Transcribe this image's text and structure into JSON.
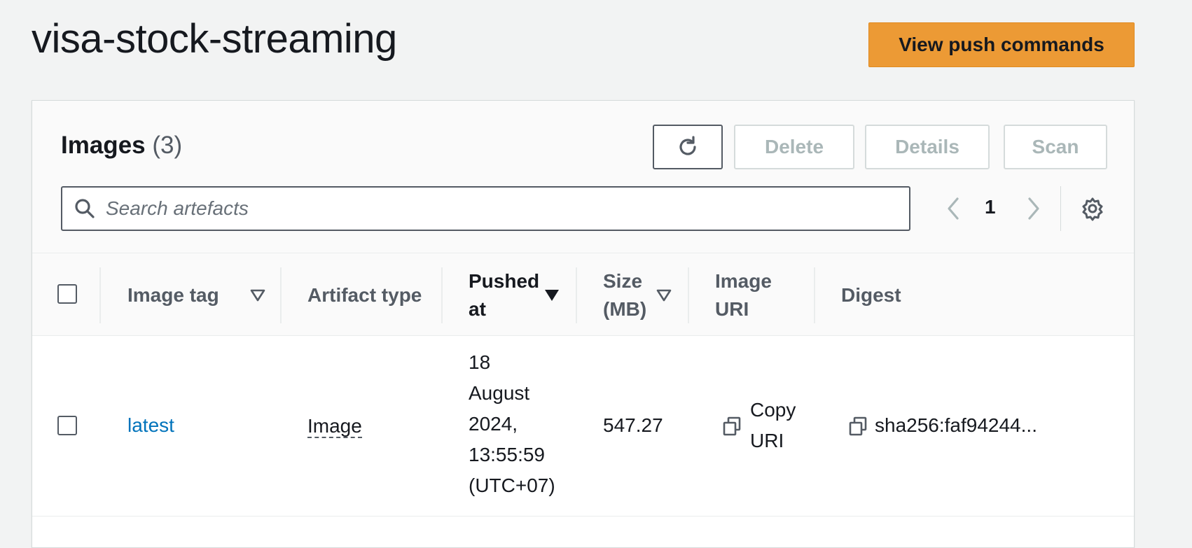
{
  "repository": {
    "name": "visa-stock-streaming",
    "push_commands_label": "View push commands"
  },
  "images_panel": {
    "title": "Images",
    "count": "(3)",
    "buttons": {
      "delete": "Delete",
      "details": "Details",
      "scan": "Scan"
    },
    "search": {
      "placeholder": "Search artefacts",
      "value": ""
    },
    "pagination": {
      "current_page": "1"
    }
  },
  "table": {
    "columns": {
      "image_tag": "Image tag",
      "artifact_type": "Artifact type",
      "pushed_at_line1": "Pushed",
      "pushed_at_line2": "at",
      "size_line1": "Size",
      "size_line2": "(MB)",
      "image_uri_line1": "Image",
      "image_uri_line2": "URI",
      "digest": "Digest"
    },
    "sort": {
      "active_column": "Pushed at",
      "direction": "descending"
    },
    "rows": [
      {
        "image_tag": "latest",
        "artifact_type": "Image",
        "pushed_at": [
          "18",
          "August",
          "2024,",
          "13:55:59",
          "(UTC+07)"
        ],
        "size_mb": "547.27",
        "image_uri_label": [
          "Copy",
          "URI"
        ],
        "digest": "sha256:faf94244..."
      }
    ]
  },
  "colors": {
    "primary_button": "#ec9a35",
    "link": "#0073bb",
    "background": "#f2f3f3"
  },
  "icons": [
    "refresh-icon",
    "search-icon",
    "chevron-left-icon",
    "chevron-right-icon",
    "settings-gear-icon",
    "sort-triangle-icon",
    "copy-icon"
  ]
}
